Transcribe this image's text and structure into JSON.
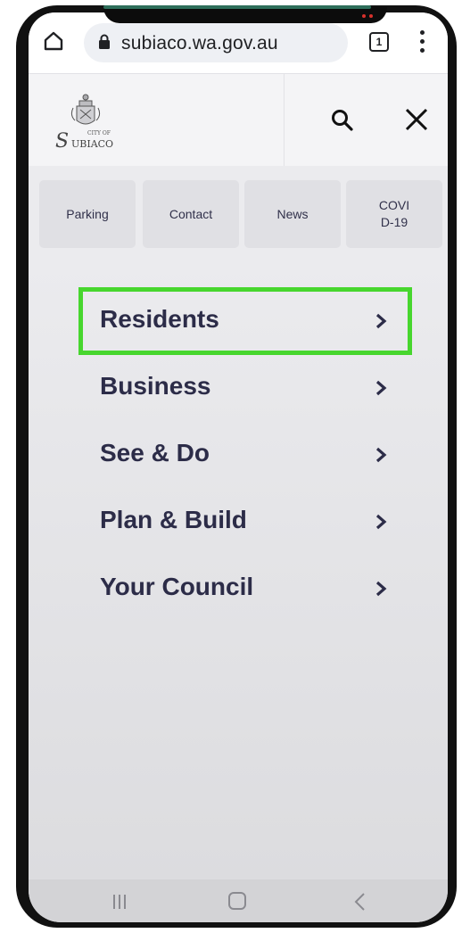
{
  "browser": {
    "url": "subiaco.wa.gov.au",
    "tab_count": "1"
  },
  "site_header": {
    "logo_small_text": "CITY OF",
    "logo_name": "UBIACO",
    "logo_initial": "S"
  },
  "quick_links": [
    {
      "label": "Parking"
    },
    {
      "label": "Contact"
    },
    {
      "label": "News"
    },
    {
      "label": "COVID-19"
    }
  ],
  "main_menu": [
    {
      "label": "Residents",
      "highlighted": true
    },
    {
      "label": "Business"
    },
    {
      "label": "See & Do"
    },
    {
      "label": "Plan & Build"
    },
    {
      "label": "Your Council"
    }
  ],
  "colors": {
    "highlight": "#47d62e",
    "menu_text": "#2c2c48",
    "header_bg": "#f4f4f6"
  },
  "icons": [
    "home-icon",
    "lock-icon",
    "tabs-icon",
    "more-vert-icon",
    "search-icon",
    "close-icon",
    "chevron-right-icon",
    "recent-apps-icon",
    "home-nav-icon",
    "back-icon"
  ]
}
